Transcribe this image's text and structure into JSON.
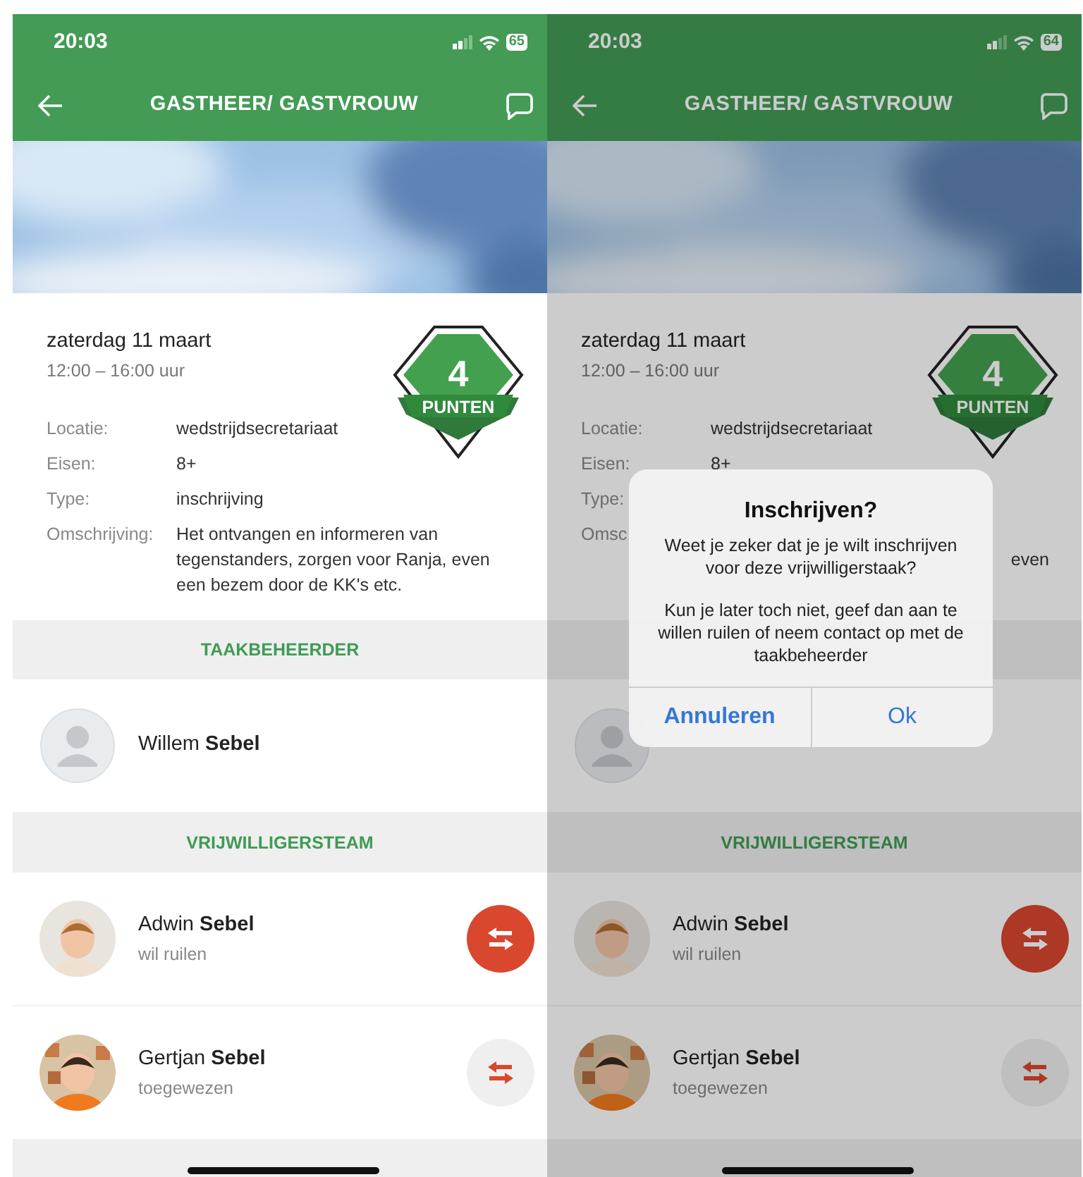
{
  "screens": [
    {
      "status_bar": {
        "time": "20:03",
        "battery": "65"
      },
      "nav": {
        "title": "GASTHEER/ GASTVROUW"
      },
      "event": {
        "date": "zaterdag 11 maart",
        "time": "12:00 – 16:00 uur"
      },
      "points": {
        "value": "4",
        "label": "PUNTEN"
      },
      "details": [
        {
          "label": "Locatie:",
          "value": "wedstrijdsecretariaat"
        },
        {
          "label": "Eisen:",
          "value": "8+"
        },
        {
          "label": "Type:",
          "value": "inschrijving"
        },
        {
          "label": "Omschrijving:",
          "value": "Het ontvangen en informeren van tegenstanders, zorgen voor Ranja, even een bezem door de KK's etc."
        }
      ],
      "manager": {
        "heading": "TAAKBEHEERDER",
        "name": "Willem **Sebel**"
      },
      "team": {
        "heading": "VRIJWILLIGERSTEAM",
        "members": [
          {
            "name": "Adwin **Sebel**",
            "status": "wil ruilen",
            "swap_requested": true
          },
          {
            "name": "Gertjan **Sebel**",
            "status": "toegewezen",
            "swap_requested": false
          }
        ]
      },
      "dimmed": false
    },
    {
      "status_bar": {
        "time": "20:03",
        "battery": "64"
      },
      "nav": {
        "title": "GASTHEER/ GASTVROUW"
      },
      "event": {
        "date": "zaterdag 11 maart",
        "time": "12:00 – 16:00 uur"
      },
      "points": {
        "value": "4",
        "label": "PUNTEN"
      },
      "details": [
        {
          "label": "Locatie:",
          "value": "wedstrijdsecretariaat"
        },
        {
          "label": "Eisen:",
          "value": "8+"
        },
        {
          "label": "Type:"
        },
        {
          "label": "Omsc",
          "value_tail": "even"
        }
      ],
      "team": {
        "heading": "VRIJWILLIGERSTEAM",
        "members": [
          {
            "name": "Adwin **Sebel**",
            "status": "wil ruilen",
            "swap_requested": true
          },
          {
            "name": "Gertjan **Sebel**",
            "status": "toegewezen",
            "swap_requested": false
          }
        ]
      },
      "dimmed": true,
      "dialog": {
        "title": "Inschrijven?",
        "message": [
          "Weet je zeker dat je je wilt inschrijven voor deze vrijwilligerstaak?",
          "Kun je later toch niet, geef dan aan te willen ruilen of neem contact op met de taakbeheerder"
        ],
        "buttons": [
          {
            "label": "Annuleren",
            "emphasized": true
          },
          {
            "label": "Ok",
            "emphasized": false
          }
        ]
      }
    }
  ]
}
